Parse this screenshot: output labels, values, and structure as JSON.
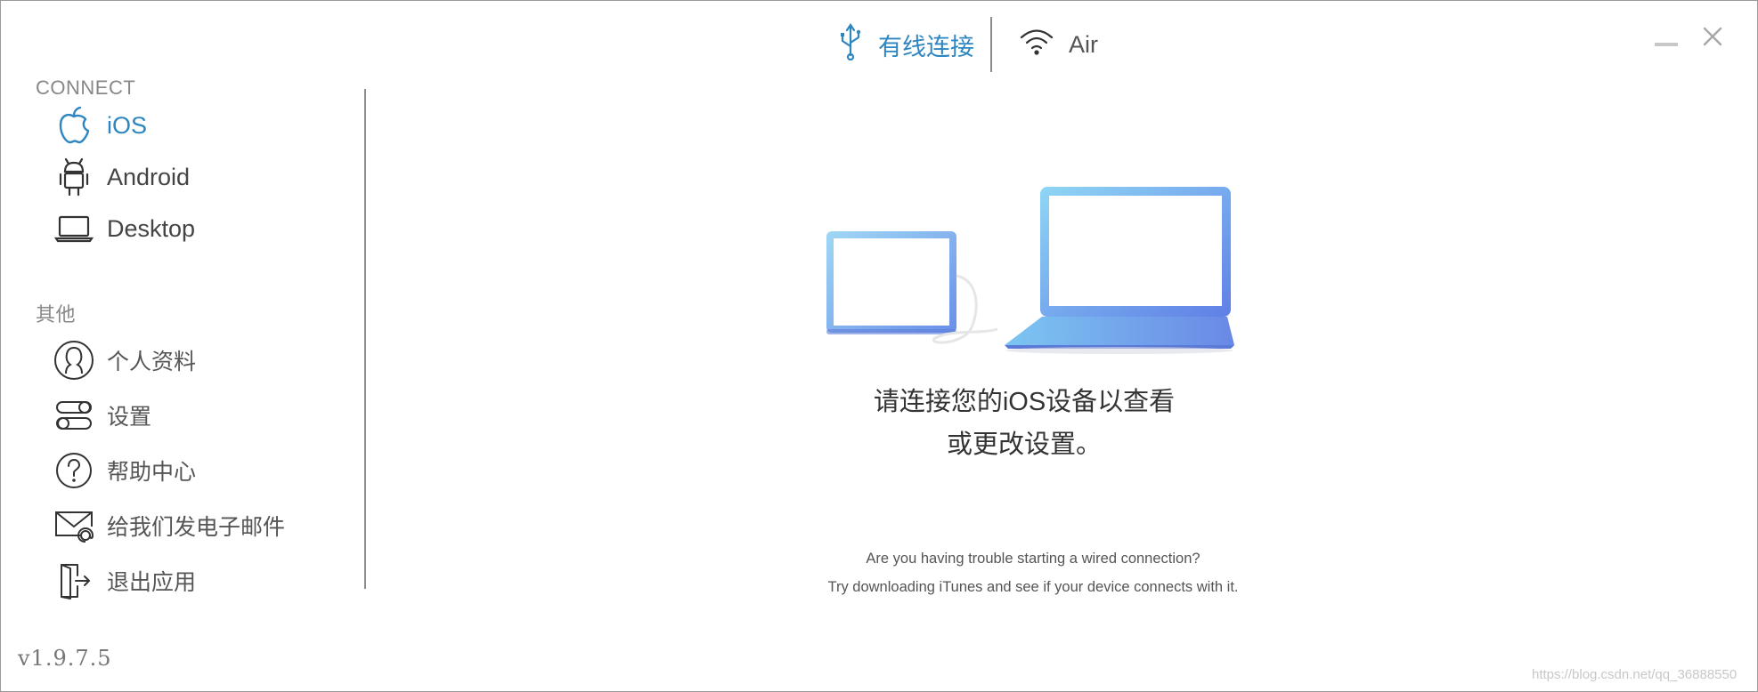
{
  "topbar": {
    "tabs": [
      {
        "label": "有线连接",
        "icon": "usb-icon",
        "active": true
      },
      {
        "label": "Air",
        "icon": "wifi-icon",
        "active": false
      }
    ]
  },
  "window_controls": {
    "minimize": "minimize-icon",
    "close": "close-icon"
  },
  "sidebar": {
    "connect_title": "CONNECT",
    "connect_items": [
      {
        "label": "iOS",
        "icon": "apple-icon",
        "active": true
      },
      {
        "label": "Android",
        "icon": "android-icon",
        "active": false
      },
      {
        "label": "Desktop",
        "icon": "laptop-icon",
        "active": false
      }
    ],
    "other_title": "其他",
    "other_items": [
      {
        "label": "个人资料",
        "icon": "profile-icon"
      },
      {
        "label": "设置",
        "icon": "settings-toggle-icon"
      },
      {
        "label": "帮助中心",
        "icon": "help-icon"
      },
      {
        "label": "给我们发电子邮件",
        "icon": "email-icon"
      },
      {
        "label": "退出应用",
        "icon": "exit-icon"
      }
    ],
    "version": "v1.9.7.5"
  },
  "main": {
    "message_line1": "请连接您的iOS设备以查看",
    "message_line2": "或更改设置。",
    "hint_line1": "Are you having trouble starting a wired connection?",
    "hint_line2": "Try downloading iTunes and see if your device connects with it."
  },
  "watermark": "https://blog.csdn.net/qq_36888550",
  "colors": {
    "accent": "#2e86c1",
    "text": "#333333",
    "muted": "#888888",
    "device_blue": "#6fb3f0"
  }
}
